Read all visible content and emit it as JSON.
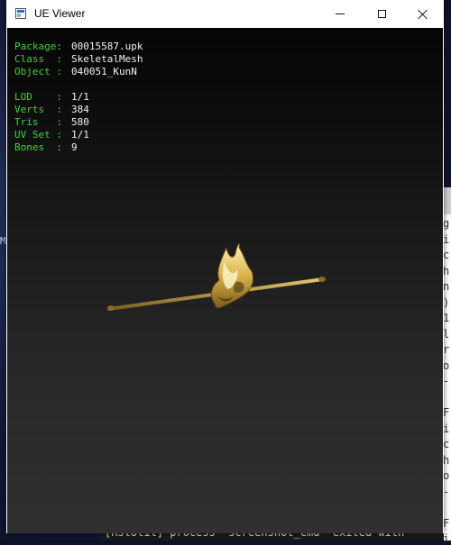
{
  "window": {
    "title": "UE Viewer"
  },
  "info_panel": {
    "package": {
      "label": "Package:",
      "value": "00015587.upk"
    },
    "class": {
      "label": "Class  :",
      "value": "SkeletalMesh"
    },
    "object": {
      "label": "Object :",
      "value": "040051_KunN"
    },
    "lod": {
      "label": "LOD    :",
      "value": "1/1"
    },
    "verts": {
      "label": "Verts  :",
      "value": "384"
    },
    "tris": {
      "label": "Tris   :",
      "value": "580"
    },
    "uvset": {
      "label": "UV Set :",
      "value": "1/1"
    },
    "bones": {
      "label": "Bones  :",
      "value": "9"
    }
  },
  "background": {
    "left_char": "M",
    "terminal_chars": [
      "g",
      "i",
      "c",
      "h",
      "n",
      ")",
      "1",
      "l",
      "r",
      "o",
      "-",
      "",
      "F",
      "i",
      "c",
      "h",
      "o",
      "-",
      "",
      "F",
      "i"
    ],
    "console_line": "[RstUtil] process \"screenshot_cmd\" exited with"
  },
  "colors": {
    "label_green": "#3bd33b",
    "value_white": "#f2f2f2"
  }
}
